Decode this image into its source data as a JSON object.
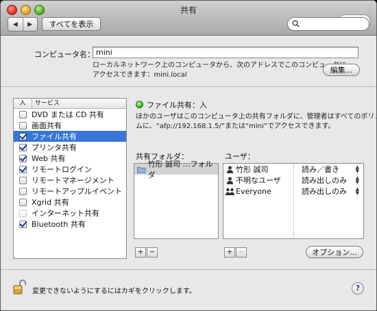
{
  "window": {
    "title": "共有",
    "show_all": "すべてを表示",
    "nav_back": "◀",
    "nav_forward": "▶"
  },
  "computer": {
    "label": "コンピュータ名：",
    "name": "mini",
    "desc_line1": "ローカルネットワーク上のコンピュータから、次のアドレスでこのコンピュータに",
    "desc_line2": "アクセスできます：mini.local",
    "edit_button": "編集..."
  },
  "services": {
    "col_on": "入",
    "col_service": "サービス",
    "items": [
      {
        "label": "DVD または CD 共有",
        "checked": false
      },
      {
        "label": "画面共有",
        "checked": false
      },
      {
        "label": "ファイル共有",
        "checked": true,
        "selected": true
      },
      {
        "label": "プリンタ共有",
        "checked": true
      },
      {
        "label": "Web 共有",
        "checked": true
      },
      {
        "label": "リモートログイン",
        "checked": true
      },
      {
        "label": "リモートマネージメント",
        "checked": false
      },
      {
        "label": "リモートアップルイベント",
        "checked": false
      },
      {
        "label": "Xgrid 共有",
        "checked": false
      },
      {
        "label": "インターネット共有",
        "checked": false,
        "dimmed": true
      },
      {
        "label": "Bluetooth 共有",
        "checked": true
      }
    ]
  },
  "file_sharing": {
    "status": "ファイル共有：入",
    "desc_line1": "ほかのユーザはこのコンピュータ上の共有フォルダに、管理者はすべてのボリュー",
    "desc_line2": "ムに、“afp://192.168.1.5/”または“mini”でアクセスできます。",
    "folders_label": "共有フォルダ：",
    "folders": [
      "竹形 誠司 …フォルダ"
    ],
    "users_label": "ユーザ：",
    "users": [
      {
        "name": "竹形 誠司",
        "perm": "読み／書き"
      },
      {
        "name": "不明なユーザ",
        "perm": "読み出しのみ"
      },
      {
        "name": "Everyone",
        "perm": "読み出しのみ"
      }
    ],
    "plus": "+",
    "minus": "−",
    "options_button": "オプション..."
  },
  "footer": {
    "lock_text": "変更できないようにするにはカギをクリックします。",
    "help": "?"
  },
  "colors": {
    "selection": "#3875d7",
    "status_green": "#2aa314"
  }
}
